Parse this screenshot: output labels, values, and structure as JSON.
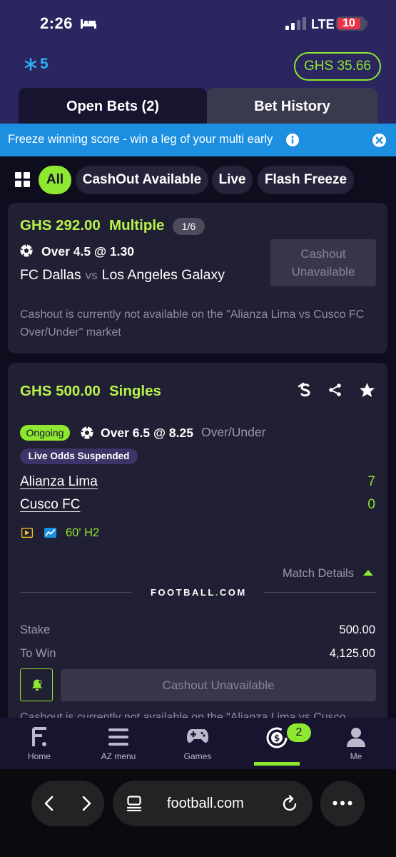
{
  "status_bar": {
    "time": "2:26",
    "network": "LTE",
    "battery": "10"
  },
  "header": {
    "freeze_count": "5",
    "balance": "GHS 35.66"
  },
  "tabs": {
    "open": "Open Bets (2)",
    "history": "Bet History"
  },
  "banner": {
    "text": "Freeze winning score - win a leg of your multi early"
  },
  "filters": {
    "all": "All",
    "cashout": "CashOut Available",
    "live": "Live",
    "flash": "Flash Freeze"
  },
  "bet1": {
    "amount": "GHS 292.00",
    "type": "Multiple",
    "legs": "1/6",
    "selection": "Over 4.5 @ 1.30",
    "home": "FC Dallas",
    "vs": "vs",
    "away": "Los Angeles Galaxy",
    "cashout_line1": "Cashout",
    "cashout_line2": "Unavailable",
    "note": "Cashout is currently not available on the \"Alianza Lima vs Cusco FC Over/Under\" market"
  },
  "bet2": {
    "amount": "GHS 500.00",
    "type": "Singles",
    "status": "Ongoing",
    "selection": "Over 6.5 @ 8.25",
    "market": "Over/Under",
    "suspended": "Live Odds Suspended",
    "team1": "Alianza Lima",
    "score1": "7",
    "team2": "Cusco FC",
    "score2": "0",
    "match_time": "60' H2",
    "match_details": "Match Details",
    "logo": "FOOTBALL",
    "logo_suffix": "COM",
    "stake_label": "Stake",
    "stake_value": "500.00",
    "win_label": "To Win",
    "win_value": "4,125.00",
    "cashout": "Cashout Unavailable",
    "note": "Cashout is currently not available on the \"Alianza Lima vs Cusco"
  },
  "bottom_nav": {
    "home": "Home",
    "az": "AZ menu",
    "games": "Games",
    "bets_badge": "2",
    "me": "Me"
  },
  "browser": {
    "url": "football.com"
  },
  "colors": {
    "accent_green": "#8de82f",
    "header_purple": "#2b2560",
    "banner_blue": "#1d8fe0",
    "card_bg": "#201f33"
  }
}
